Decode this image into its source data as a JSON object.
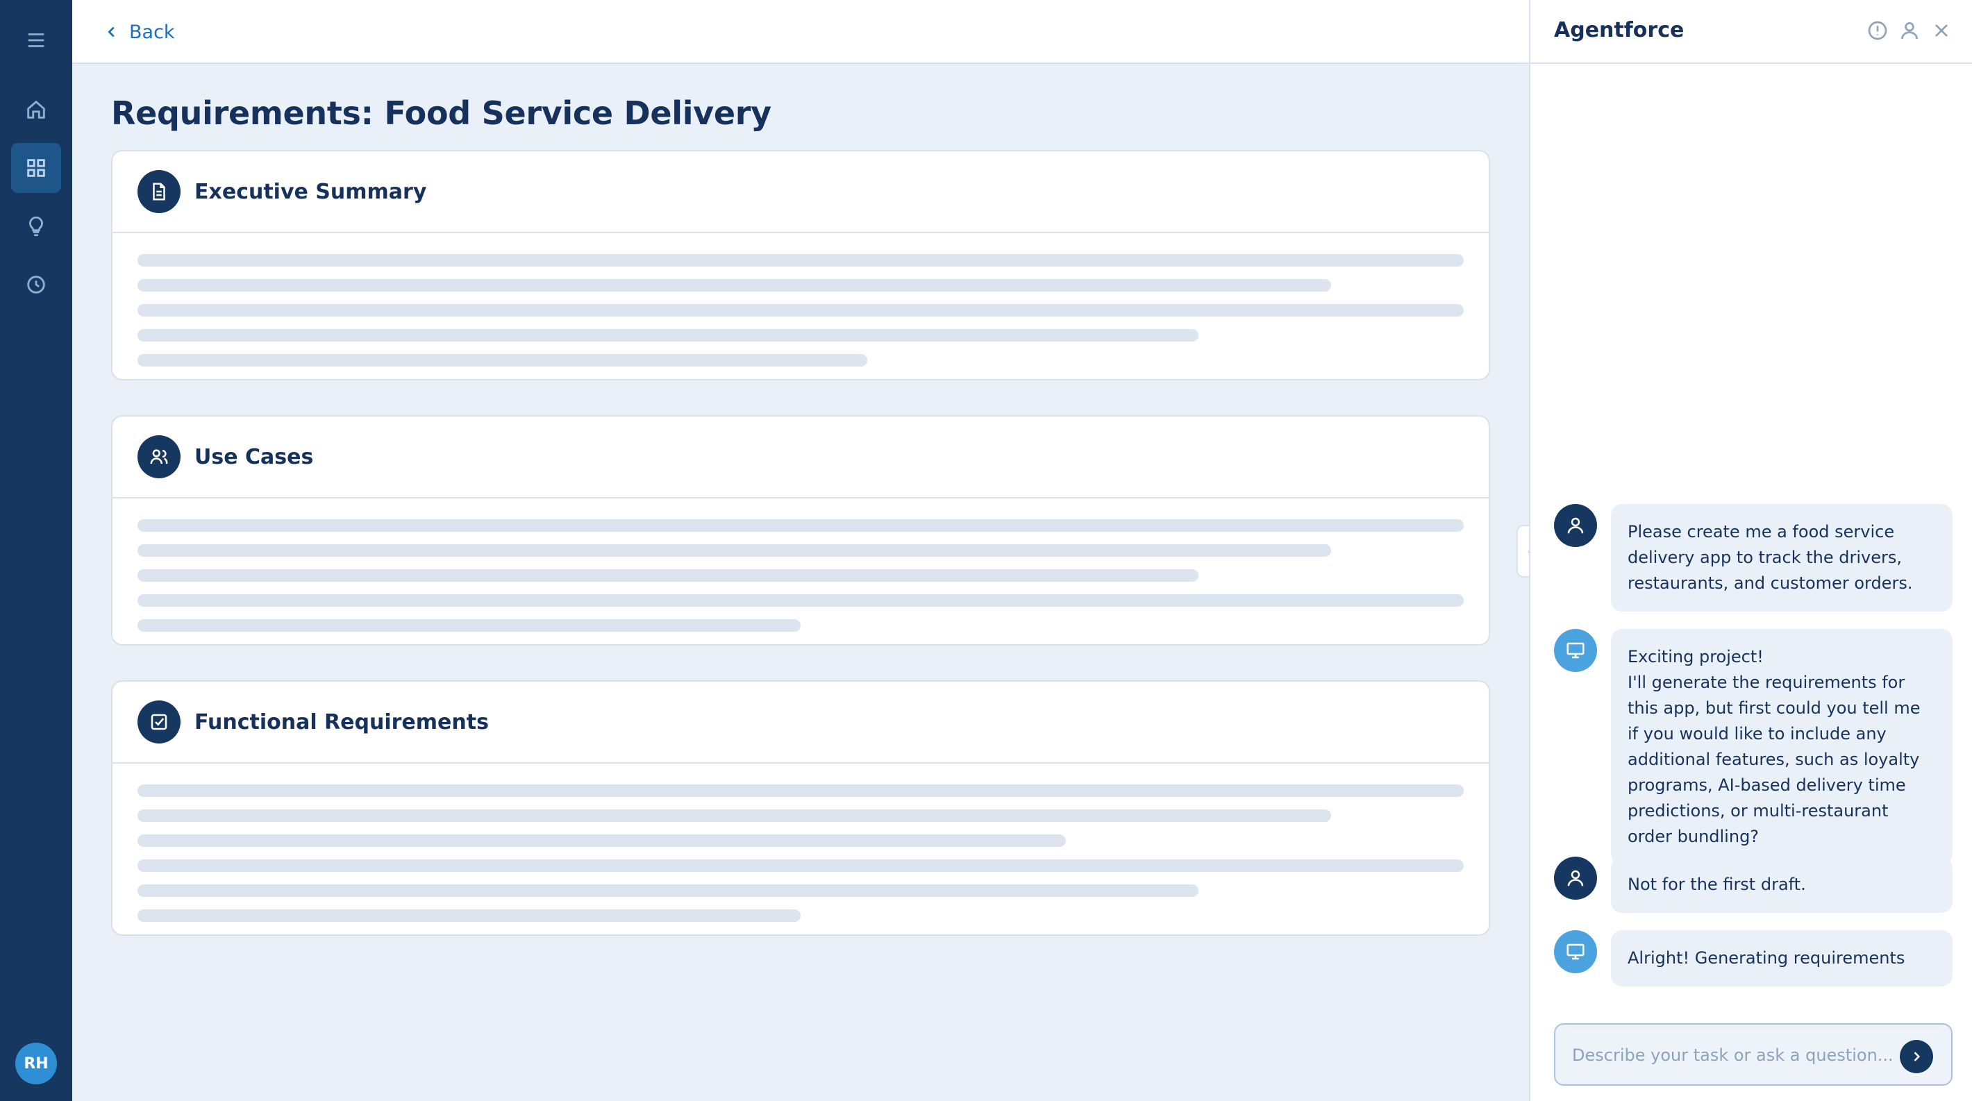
{
  "nav": {
    "back_label": "Back"
  },
  "rail": {
    "items": [
      {
        "icon": "menu-icon"
      },
      {
        "icon": "home-icon"
      },
      {
        "icon": "grid-icon",
        "active": true
      },
      {
        "icon": "lightbulb-icon"
      },
      {
        "icon": "clock-icon"
      }
    ],
    "user_initials": "RH"
  },
  "main": {
    "title": "Requirements: Food Service Delivery",
    "sections": [
      {
        "title": "Executive Summary",
        "icon": "document-icon"
      },
      {
        "title": "Use Cases",
        "icon": "users-icon"
      },
      {
        "title": "Functional Requirements",
        "icon": "checkbox-icon"
      }
    ]
  },
  "agent": {
    "title": "Agentforce",
    "messages": [
      {
        "role": "user",
        "text": "Please create me a food service delivery app to track the drivers, restaurants, and customer orders."
      },
      {
        "role": "bot",
        "text": "Exciting project!\nI'll generate the requirements for this app, but first could you tell me if you would like to include any additional features, such as loyalty programs, AI-based delivery time predictions, or multi-restaurant order bundling?"
      },
      {
        "role": "user",
        "text": "Not for the first draft."
      },
      {
        "role": "bot",
        "text": "Alright! Generating requirements"
      }
    ],
    "input_placeholder": "Describe your task or ask a question..."
  },
  "colors": {
    "rail_bg": "#16375f",
    "accent": "#1b6fb8",
    "bot_avatar": "#4aa3df",
    "page_bg": "#eaf0f7"
  }
}
